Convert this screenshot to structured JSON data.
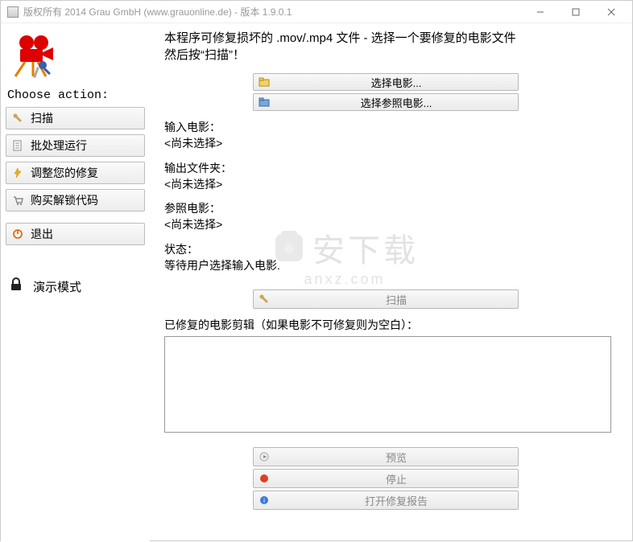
{
  "window": {
    "title": "版权所有 2014 Grau GmbH (www.grauonline.de) - 版本 1.9.0.1"
  },
  "sidebar": {
    "choose_label": "Choose action:",
    "buttons": {
      "scan": "扫描",
      "batch": "批处理运行",
      "tune": "调整您的修复",
      "buy": "购买解锁代码",
      "exit": "退出"
    },
    "demo_label": "演示模式"
  },
  "main": {
    "intro_line1": "本程序可修复损坏的 .mov/.mp4 文件 - 选择一个要修复的电影文件",
    "intro_line2": "然后按“扫描”！",
    "choose_movie": "选择电影...",
    "choose_ref": "选择参照电影...",
    "input_movie_label": "输入电影：",
    "input_movie_value": "<尚未选择>",
    "output_folder_label": "输出文件夹：",
    "output_folder_value": "<尚未选择>",
    "ref_movie_label": "参照电影：",
    "ref_movie_value": "<尚未选择>",
    "state_label": "状态：",
    "state_value": "等待用户选择输入电影.",
    "scan_button": "扫描",
    "fixed_clips_label": "已修复的电影剪辑（如果电影不可修复则为空白）：",
    "preview": "预览",
    "stop": "停止",
    "open_report": "打开修复报告"
  },
  "watermark": {
    "brand_cn": "安下载",
    "brand_en": "anxz.com"
  }
}
